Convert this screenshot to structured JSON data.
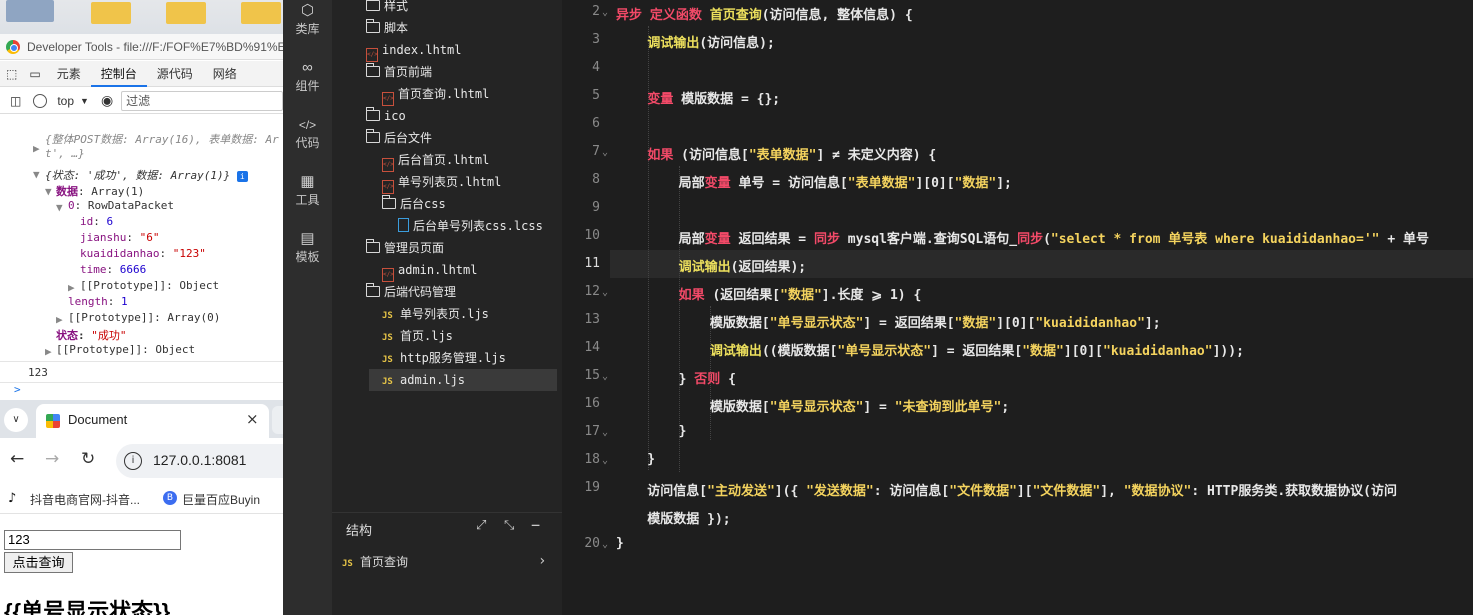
{
  "devtools": {
    "title": "Developer Tools - file:///F:/FOF%E7%BD%91%E7",
    "tabs": [
      "元素",
      "控制台",
      "源代码",
      "网络"
    ],
    "active_tab": "控制台",
    "context": "top",
    "filter_placeholder": "过滤",
    "console": {
      "line1": "{整体POST数据: Array(16), 表单数据: Ar",
      "line1b": "t', …}",
      "line2": "{状态: '成功', 数据: Array(1)}",
      "info_badge": "i",
      "data_key": "数据",
      "data_val": ": Array(1)",
      "item0_key": "0",
      "item0_val": ": RowDataPacket",
      "id_key": "id",
      "id_val": "6",
      "jianshu_key": "jianshu",
      "jianshu_val": "\"6\"",
      "kuai_key": "kuaididanhao",
      "kuai_val": "\"123\"",
      "time_key": "time",
      "time_val": "6666",
      "proto_obj": "[[Prototype]]: Object",
      "length_key": "length",
      "length_val": "1",
      "proto_arr": "[[Prototype]]: Array(0)",
      "status_key": "状态",
      "status_val": "\"成功\"",
      "proto_obj2": "[[Prototype]]: Object",
      "output": "123",
      "prompt": ">"
    }
  },
  "browser": {
    "tab_title": "Document",
    "url": "127.0.0.1:8081",
    "bookmark1": "抖音电商官网-抖音...",
    "bookmark2": "巨量百应Buyin",
    "input_value": "123",
    "button_label": "点击查询",
    "heading": "{{单号显示状态}}"
  },
  "sidebar": {
    "items": [
      "类库",
      "组件",
      "代码",
      "工具",
      "模板"
    ]
  },
  "tree": {
    "items": [
      "样式",
      "脚本",
      "index.lhtml",
      "首页前端",
      "首页查询.lhtml",
      "ico",
      "后台文件",
      "后台首页.lhtml",
      "单号列表页.lhtml",
      "后台css",
      "后台单号列表css.lcss",
      "管理员页面",
      "admin.lhtml",
      "后端代码管理",
      "单号列表页.ljs",
      "首页.ljs",
      "http服务管理.ljs",
      "admin.ljs"
    ],
    "structure_title": "结构",
    "structure_item": "首页查询"
  },
  "editor": {
    "line_numbers": [
      "2",
      "3",
      "4",
      "5",
      "6",
      "7",
      "8",
      "9",
      "10",
      "11",
      "12",
      "13",
      "14",
      "15",
      "16",
      "17",
      "18",
      "19",
      "",
      "20"
    ],
    "lines": [
      "异步 定义函数 首页查询(访问信息, 整体信息) {",
      "    调试输出(访问信息);",
      "",
      "    变量 模版数据 = {};",
      "",
      "    如果 (访问信息[\"表单数据\"] ≠ 未定义内容) {",
      "        局部变量 单号 = 访问信息[\"表单数据\"][0][\"数据\"];",
      "",
      "        局部变量 返回结果 = 同步 mysql客户端.查询SQL语句_同步(\"select * from 单号表 where kuaididanhao='\" + 单号",
      "        调试输出(返回结果);",
      "        如果 (返回结果[\"数据\"].长度 ⩾ 1) {",
      "            模版数据[\"单号显示状态\"] = 返回结果[\"数据\"][0][\"kuaididanhao\"];",
      "            调试输出((模版数据[\"单号显示状态\"] = 返回结果[\"数据\"][0][\"kuaididanhao\"]));",
      "        } 否则 {",
      "            模版数据[\"单号显示状态\"] = \"未查询到此单号\";",
      "        }",
      "    }",
      "    访问信息[\"主动发送\"]({ \"发送数据\": 访问信息[\"文件数据\"][\"文件数据\"], \"数据协议\": HTTP服务类.获取数据协议(访问",
      "    模版数据 });",
      "}"
    ]
  }
}
